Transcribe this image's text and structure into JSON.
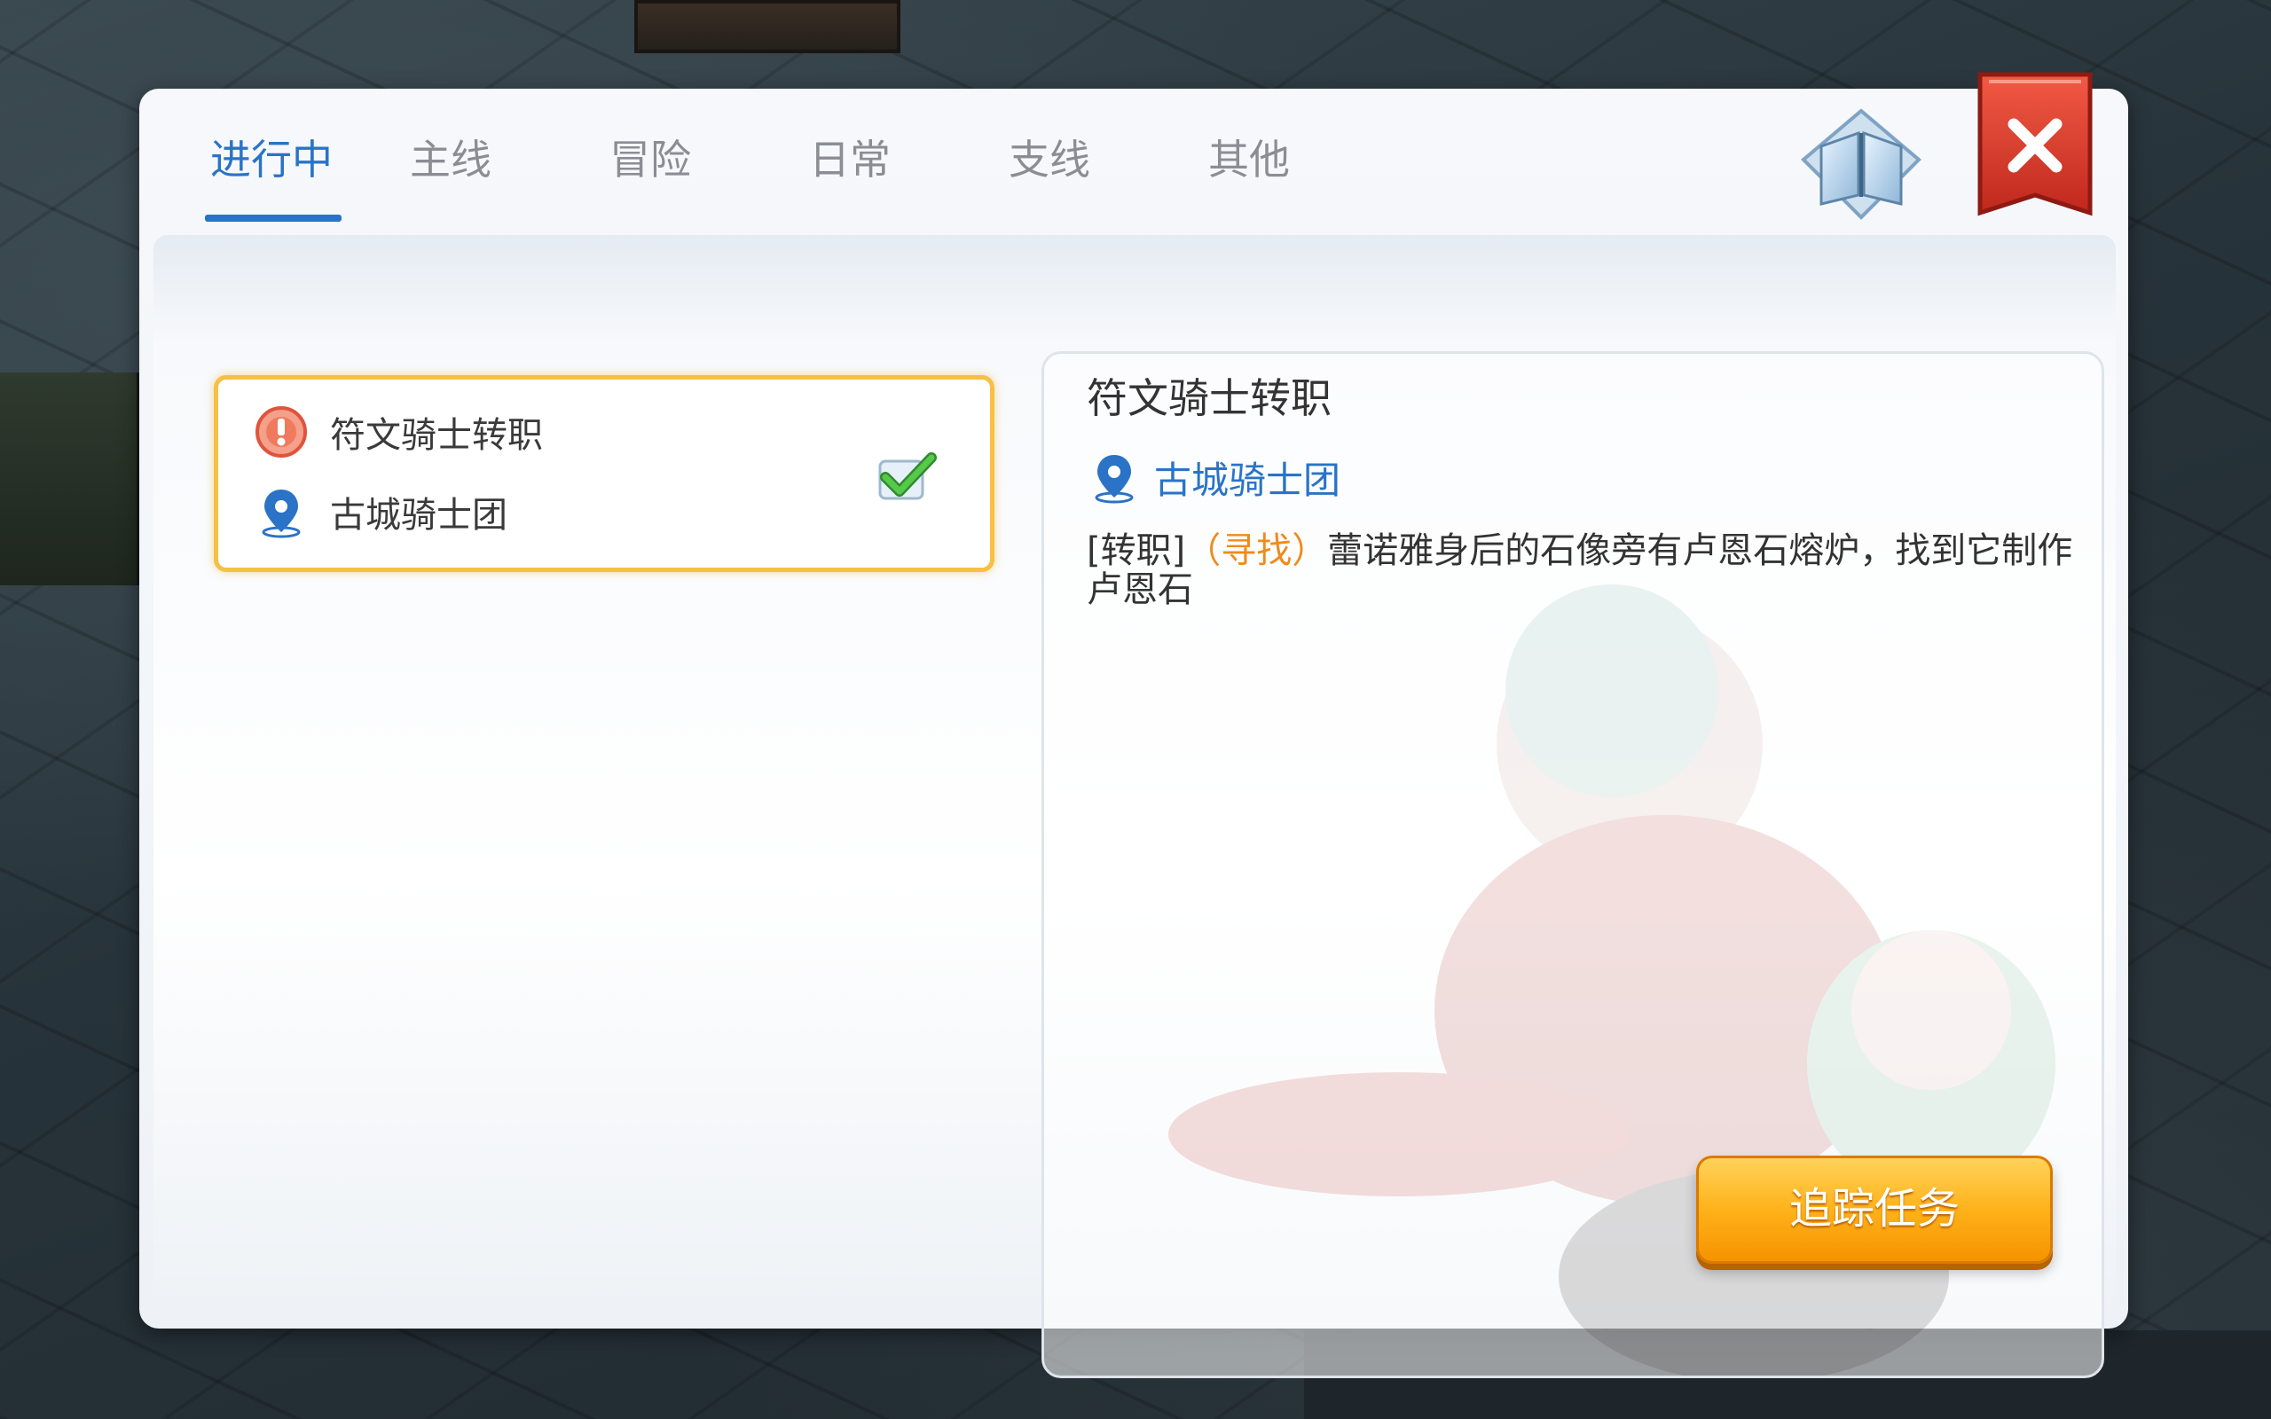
{
  "tabs": [
    {
      "label": "进行中",
      "active": true
    },
    {
      "label": "主线",
      "active": false
    },
    {
      "label": "冒险",
      "active": false
    },
    {
      "label": "日常",
      "active": false
    },
    {
      "label": "支线",
      "active": false
    },
    {
      "label": "其他",
      "active": false
    }
  ],
  "icons": {
    "codex": "open-book-crystal-icon",
    "close": "close-icon",
    "quest_type": "alert-icon",
    "location": "map-pin-icon",
    "tracked": "checkmark-icon"
  },
  "quest_list": [
    {
      "title": "符文骑士转职",
      "location": "古城骑士团",
      "tracked": true
    }
  ],
  "detail": {
    "title": "符文骑士转职",
    "location": "古城骑士团",
    "desc_prefix": "[转职]",
    "desc_highlight": "（寻找）",
    "desc_body": "蕾诺雅身后的石像旁有卢恩石熔炉，找到它制作卢恩石"
  },
  "track_button": "追踪任务",
  "colors": {
    "accent": "#2a73c7",
    "highlight": "#f08a1c",
    "card_border": "#f5c044",
    "close_red": "#d9362b",
    "button_orange": "#ffb21a"
  }
}
